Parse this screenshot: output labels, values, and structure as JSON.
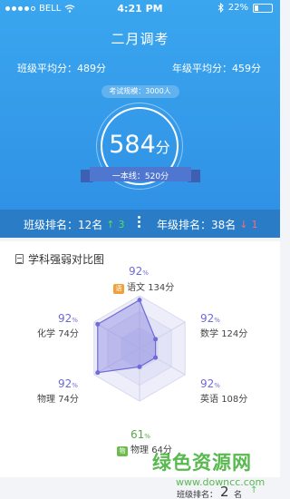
{
  "status_bar": {
    "carrier": "BELL",
    "time": "4:21 PM",
    "battery": "22%",
    "battery_level": 0.22
  },
  "exam": {
    "title": "二月调考"
  },
  "averages": {
    "class_avg": "班级平均分：489分",
    "grade_avg": "年级平均分：459分"
  },
  "exam_size": "考试规模：3000人",
  "score": {
    "value": "584",
    "unit": "分",
    "line_label": "一本线：520分"
  },
  "ranking": {
    "class_rank": "班级排名：12名",
    "class_change": "3",
    "grade_rank": "年级排名：38名",
    "grade_change": "1"
  },
  "chart_card": {
    "title": "学科强弱对比图"
  },
  "chart_data": {
    "type": "radar",
    "title": "学科强弱对比图",
    "subjects": [
      {
        "name": "语文",
        "score": "134分",
        "percent": "92",
        "value": 92
      },
      {
        "name": "数学",
        "score": "124分",
        "percent": "92",
        "value": 92
      },
      {
        "name": "英语",
        "score": "108分",
        "percent": "92",
        "value": 92
      },
      {
        "name": "物理",
        "score": "64分",
        "percent": "61",
        "value": 61
      },
      {
        "name": "物理",
        "score": "74分",
        "percent": "92",
        "value": 92
      },
      {
        "name": "化学",
        "score": "74分",
        "percent": "92",
        "value": 92
      }
    ],
    "percent_unit": "%",
    "plotted_values": [
      0.92,
      0.35,
      0.35,
      0.35,
      0.92,
      0.92
    ],
    "colors": {
      "line": "#6f6bd8",
      "fill": "rgba(111,107,216,0.35)",
      "grid": "#e4e4f6"
    }
  },
  "footer": {
    "rank_label": "班级排名：",
    "rank_value": "2",
    "rank_unit": "名"
  },
  "watermark": {
    "main": "绿色资源网",
    "sub": "www.downcc.com"
  }
}
